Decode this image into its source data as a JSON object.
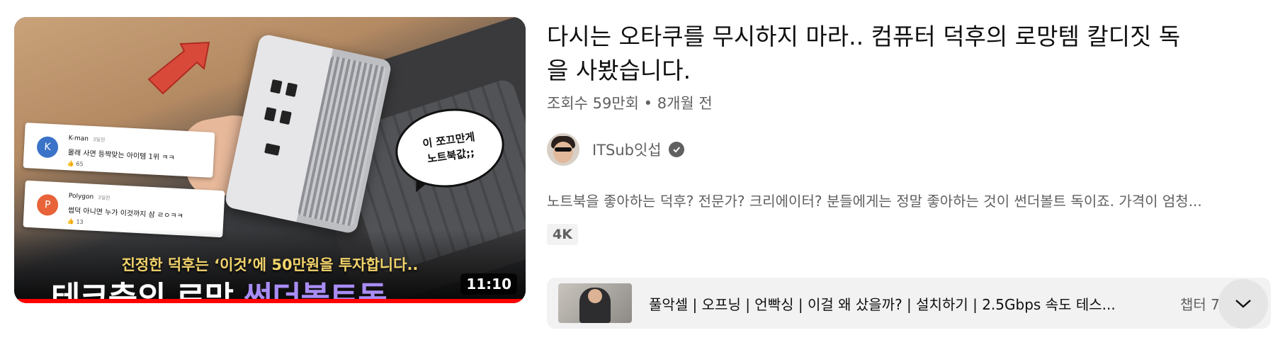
{
  "video": {
    "thumbnail": {
      "duration": "11:10",
      "overlay_subtitle": "진정한 덕후는 ‘이것’에 50만원을 투자합니다..",
      "overlay_title_main": "테크충의 로망 ",
      "overlay_title_accent": "썬더볼트독",
      "bubble_line1": "이 쪼끄만게",
      "bubble_line2": "노트북값;;",
      "comments": [
        {
          "avatar_letter": "K",
          "name": "K-man",
          "when": "3일전",
          "text": "몰래 사면 등짝맞는 아이템 1위 ㅋㅋ",
          "likes": "65",
          "color": "#3b73c8"
        },
        {
          "avatar_letter": "P",
          "name": "Polygon",
          "when": "3일전",
          "text": "썹덕 아니면 누가 이것까지 삼 ㄹㅇㅋㅋ",
          "likes": "13",
          "color": "#e8633a"
        }
      ]
    },
    "title": "다시는 오타쿠를 무시하지 마라.. 컴퓨터 덕후의 로망템 칼디짓 독을 사봤습니다.",
    "meta": "조회수 59만회 • 8개월 전",
    "channel": {
      "name": "ITSub잇섭",
      "verified_icon": "check-circle-icon"
    },
    "description": "노트북을 좋아하는 덕후? 전문가? 크리에이터? 분들에게는 정말 좋아하는 것이 썬더볼트 독이죠. 가격이 엄청...",
    "badge": "4K",
    "chapters": {
      "text": "풀악셀 | 오프닝 | 언빡싱 | 이걸 왜 샀을까? | 설치하기 | 2.5Gbps 속도 테스...",
      "count": "챕터 7",
      "expand_icon": "chevron-down-icon"
    }
  },
  "colors": {
    "progress": "#ff0000",
    "accent_text": "#a98df5",
    "secondary_text": "#606060"
  }
}
